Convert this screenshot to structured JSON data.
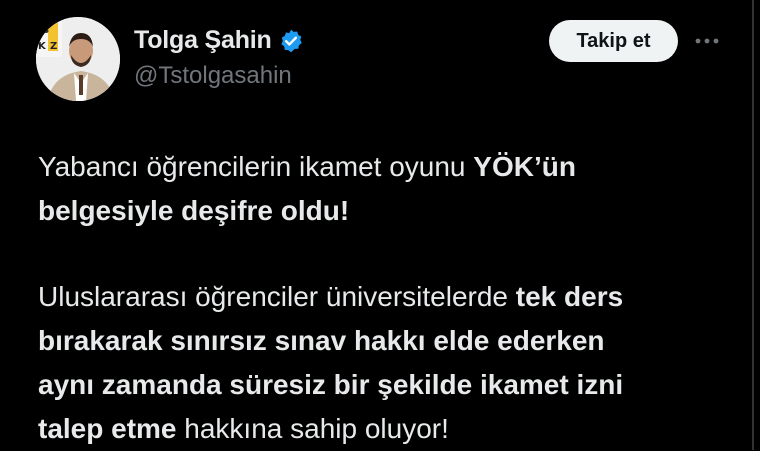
{
  "author": {
    "display_name": "Tolga Şahin",
    "handle": "@Tstolgasahin",
    "verified_icon": "verified-badge",
    "verified_color": "#1d9bf0"
  },
  "actions": {
    "follow_label": "Takip et",
    "more_icon": "more-horizontal"
  },
  "tweet": {
    "paragraph1": {
      "line1_a": "Yabancı öğrencilerin ikamet oyunu ",
      "line1_b": "YÖK’ün",
      "line2": "belgesiyle deşifre oldu!"
    },
    "paragraph2": {
      "line1_a": "Uluslararası öğrenciler üniversitelerde ",
      "line1_b": "tek ders",
      "line2": "bırakarak sınırsız sınav hakkı elde ederken",
      "line3": "aynı zamanda süresiz bir şekilde ikamet izni",
      "line4_a": "talep etme",
      "line4_b": " hakkına sahip oluyor!"
    }
  },
  "colors": {
    "background": "#000000",
    "text": "#e7e9ea",
    "secondary_text": "#71767b",
    "button_bg": "#eff3f4"
  }
}
